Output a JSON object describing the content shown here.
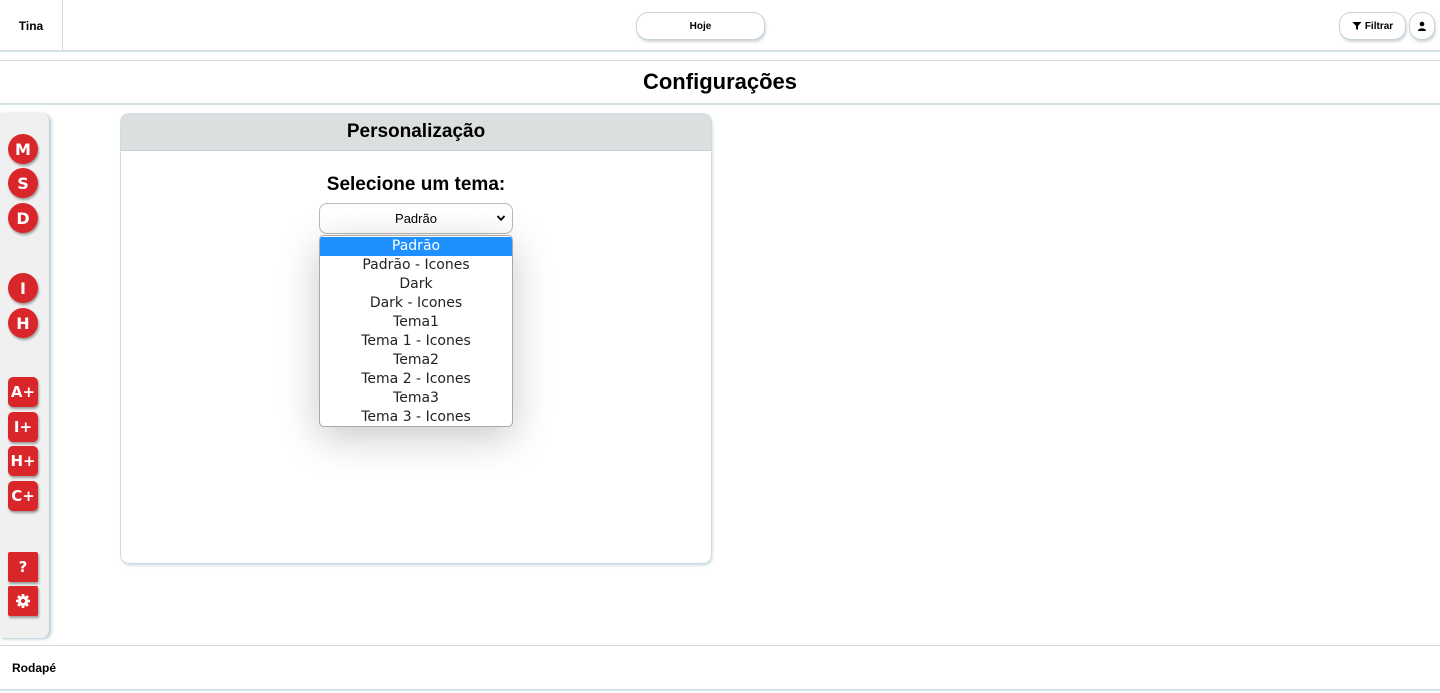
{
  "header": {
    "brand": "Tina",
    "today_label": "Hoje",
    "filter_label": "Filtrar",
    "filter_icon": "filter-icon",
    "user_icon": "user-icon"
  },
  "page": {
    "title": "Configurações"
  },
  "sidebar": {
    "items": [
      {
        "label": "M"
      },
      {
        "label": "S"
      },
      {
        "label": "D"
      },
      {
        "label": "I"
      },
      {
        "label": "H"
      },
      {
        "label": "A+"
      },
      {
        "label": "I+"
      },
      {
        "label": "H+"
      },
      {
        "label": "C+"
      },
      {
        "label": "?"
      },
      {
        "icon": "gear-icon"
      }
    ],
    "accent_color": "#d9262b"
  },
  "card": {
    "title": "Personalização",
    "select_label": "Selecione um tema:",
    "selected_value": "Padrão",
    "options": [
      "Padrão",
      "Padrão - Icones",
      "Dark",
      "Dark - Icones",
      "Tema1",
      "Tema 1 - Icones",
      "Tema2",
      "Tema 2 - Icones",
      "Tema3",
      "Tema 3 - Icones"
    ],
    "highlight_color": "#1e90ff"
  },
  "footer": {
    "text": "Rodapé"
  }
}
